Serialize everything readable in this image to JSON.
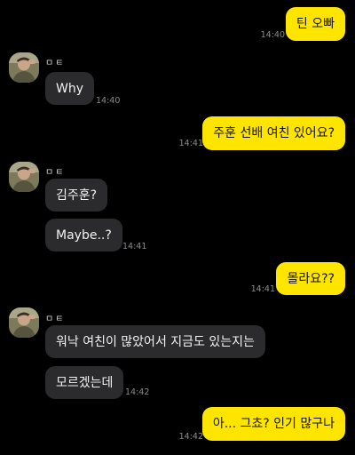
{
  "colors": {
    "background": "#000000",
    "my_bubble": "#FEE500",
    "their_bubble": "#2b2b2d",
    "timestamp": "#8b8b8b"
  },
  "messages": [
    {
      "from": "me",
      "text": "틴 오빠",
      "time": "14:40"
    },
    {
      "from": "them",
      "sender": "ㅁㅌ",
      "text": "Why",
      "time": "14:40"
    },
    {
      "from": "me",
      "text": "주훈 선배 여친 있어요?",
      "time": "14:41"
    },
    {
      "from": "them",
      "sender": "ㅁㅌ",
      "text": "김주훈?",
      "time": ""
    },
    {
      "from": "them",
      "text": "Maybe..?",
      "time": "14:41"
    },
    {
      "from": "me",
      "text": "몰라요??",
      "time": "14:41"
    },
    {
      "from": "them",
      "sender": "ㅁㅌ",
      "text": "워낙 여친이 많았어서 지금도 있는지는",
      "time": ""
    },
    {
      "from": "them",
      "text": "모르겠는데",
      "time": "14:42"
    },
    {
      "from": "me",
      "text": "아... 그쵸? 인기 많구나",
      "time": "14:42"
    }
  ]
}
